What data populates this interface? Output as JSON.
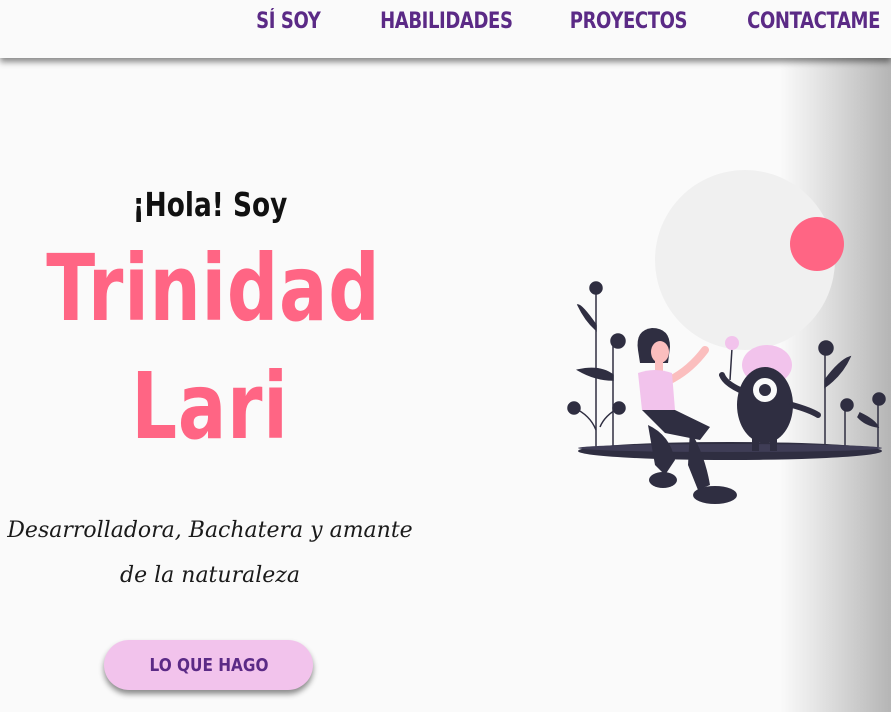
{
  "nav": {
    "items": [
      {
        "label": "SÍ SOY"
      },
      {
        "label": "HABILIDADES"
      },
      {
        "label": "PROYECTOS"
      },
      {
        "label": "CONTACTAME"
      }
    ]
  },
  "hero": {
    "greeting": "¡Hola! Soy",
    "first_name": "Trinidad",
    "last_name": "Lari",
    "tagline_line1": "Desarrolladora, Bachatera y amante",
    "tagline_line2": "de la naturaleza",
    "cta_label": "LO QUE HAGO"
  },
  "colors": {
    "accent_pink": "#ff6584",
    "nav_purple": "#5b2a86",
    "button_bg": "#f2c3ec",
    "illustration_dark": "#2f2e41"
  },
  "illustration": {
    "icon": "woman-with-monster-illustration"
  }
}
